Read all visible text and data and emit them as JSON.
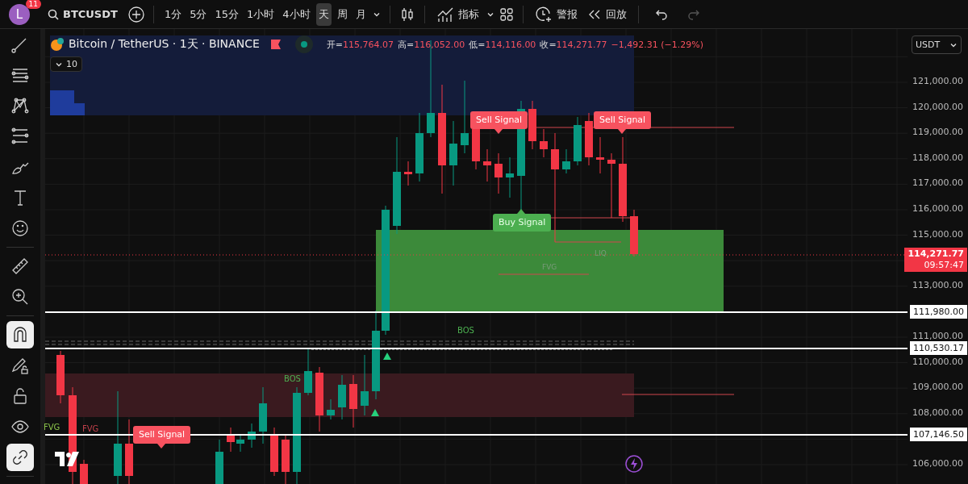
{
  "toolbar": {
    "avatar": "L",
    "notification_count": "11",
    "symbol": "BTCUSDT",
    "intervals": [
      {
        "label": "1分",
        "selected": false
      },
      {
        "label": "5分",
        "selected": false
      },
      {
        "label": "15分",
        "selected": false
      },
      {
        "label": "1小时",
        "selected": false
      },
      {
        "label": "4小时",
        "selected": false
      },
      {
        "label": "天",
        "selected": true
      },
      {
        "label": "周",
        "selected": false
      },
      {
        "label": "月",
        "selected": false
      }
    ],
    "indicators_button": "指标",
    "alert_button": "警报",
    "replay_button": "回放",
    "history": [
      {
        "kind": "undo",
        "disabled": false
      },
      {
        "kind": "redo",
        "disabled": true
      }
    ]
  },
  "left_toolbar": {
    "tools": [
      {
        "kind": "trend-line",
        "on": false
      },
      {
        "kind": "fib",
        "on": false
      },
      {
        "kind": "pattern",
        "on": false
      },
      {
        "kind": "forecast",
        "on": false
      },
      {
        "kind": "brush",
        "on": false
      },
      {
        "kind": "text",
        "on": false
      },
      {
        "kind": "emoji",
        "on": false
      },
      {
        "kind": "ruler",
        "on": false
      },
      {
        "kind": "zoom",
        "on": false
      },
      {
        "kind": "magnet",
        "on": true
      },
      {
        "kind": "draw-lock",
        "on": false
      },
      {
        "kind": "lock",
        "on": false
      },
      {
        "kind": "eye",
        "on": false
      },
      {
        "kind": "link",
        "on": true
      }
    ]
  },
  "legend": {
    "title": "Bitcoin / TetherUS · 1天 · BINANCE",
    "values": [
      {
        "label": "开=",
        "value": "115,764.07"
      },
      {
        "label": "高=",
        "value": "116,052.00"
      },
      {
        "label": "低=",
        "value": "114,116.00"
      },
      {
        "label": "收=",
        "value": "114,271.77"
      }
    ],
    "change": "−1,492.31 (−1.29%)",
    "indicator_count": "10"
  },
  "signals": [
    {
      "kind": "sell",
      "text": "Sell Signal"
    },
    {
      "kind": "sell",
      "text": "Sell Signal"
    },
    {
      "kind": "sell",
      "text": "Sell Signal"
    },
    {
      "kind": "buy",
      "text": "Buy Signal"
    }
  ],
  "zone_labels": [
    {
      "kind": "bos",
      "text": "BOS"
    },
    {
      "kind": "bos",
      "text": "BOS"
    },
    {
      "kind": "fvg",
      "text": "FVG"
    },
    {
      "kind": "fvg-bear",
      "text": "FVG"
    },
    {
      "kind": "faint",
      "text": "FVG"
    },
    {
      "kind": "faint",
      "text": "LIQ"
    }
  ],
  "price_axis": {
    "currency": "USDT",
    "ticks": [
      "121,000.00",
      "120,000.00",
      "119,000.00",
      "118,000.00",
      "117,000.00",
      "116,000.00",
      "115,000.00",
      "113,000.00",
      "111,000.00",
      "110,000.00",
      "109,000.00",
      "108,000.00",
      "106,000.00"
    ],
    "level_labels": [
      "111,980.00",
      "110,530.17",
      "107,146.50"
    ],
    "current_price": "114,271.77",
    "countdown": "09:57:47"
  }
}
